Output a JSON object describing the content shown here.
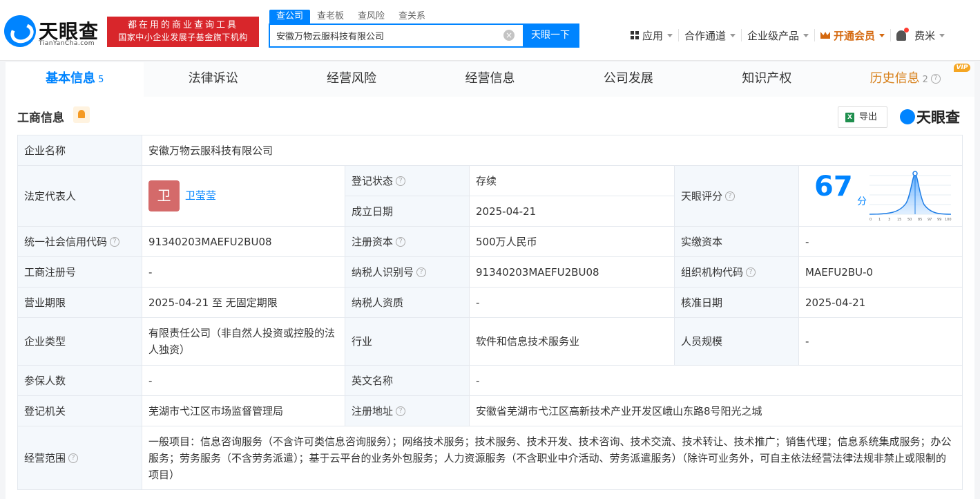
{
  "brand": {
    "name": "天眼查",
    "domain": "TianYanCha.com",
    "promo_line1": "都在用的商业查询工具",
    "promo_line2": "国家中小企业发展子基金旗下机构"
  },
  "search": {
    "tabs": [
      "查公司",
      "查老板",
      "查风险",
      "查关系"
    ],
    "value": "安徽万物云服科技有限公司",
    "button": "天眼一下"
  },
  "nav": {
    "apps": "应用",
    "partners": "合作通道",
    "enterprise": "企业级产品",
    "vip": "开通会员",
    "user": "费米"
  },
  "main_tabs": [
    {
      "label": "基本信息",
      "count": "5"
    },
    {
      "label": "法律诉讼"
    },
    {
      "label": "经营风险"
    },
    {
      "label": "经营信息"
    },
    {
      "label": "公司发展"
    },
    {
      "label": "知识产权"
    },
    {
      "label": "历史信息",
      "count": "2",
      "badge": "VIP"
    }
  ],
  "panel": {
    "title": "工商信息",
    "export": "导出",
    "brand": "天眼查"
  },
  "info": {
    "company_name_label": "企业名称",
    "company_name": "安徽万物云服科技有限公司",
    "legal_rep_label": "法定代表人",
    "legal_rep_avatar": "卫",
    "legal_rep": "卫莹莹",
    "reg_status_label": "登记状态",
    "reg_status": "存续",
    "found_date_label": "成立日期",
    "found_date": "2025-04-21",
    "score_label": "天眼评分",
    "score": "67",
    "score_unit": "分",
    "score_axis": [
      "0",
      "1",
      "3",
      "15",
      "50",
      "85",
      "97",
      "99",
      "100"
    ],
    "credit_code_label": "统一社会信用代码",
    "credit_code": "91340203MAEFU2BU08",
    "reg_capital_label": "注册资本",
    "reg_capital": "500万人民币",
    "paid_capital_label": "实缴资本",
    "paid_capital": "-",
    "reg_no_label": "工商注册号",
    "reg_no": "-",
    "tax_id_label": "纳税人识别号",
    "tax_id": "91340203MAEFU2BU08",
    "org_code_label": "组织机构代码",
    "org_code": "MAEFU2BU-0",
    "term_label": "营业期限",
    "term": "2025-04-21 至 无固定期限",
    "taxpayer_label": "纳税人资质",
    "taxpayer": "-",
    "approve_date_label": "核准日期",
    "approve_date": "2025-04-21",
    "type_label": "企业类型",
    "type": "有限责任公司（非自然人投资或控股的法人独资）",
    "industry_label": "行业",
    "industry": "软件和信息技术服务业",
    "staff_label": "人员规模",
    "staff": "-",
    "insured_label": "参保人数",
    "insured": "-",
    "en_name_label": "英文名称",
    "en_name": "-",
    "authority_label": "登记机关",
    "authority": "芜湖市弋江区市场监督管理局",
    "address_label": "注册地址",
    "address": "安徽省芜湖市弋江区高新技术产业开发区峨山东路8号阳光之城",
    "scope_label": "经营范围",
    "scope": "一般项目：信息咨询服务（不含许可类信息咨询服务）；网络技术服务；技术服务、技术开发、技术咨询、技术交流、技术转让、技术推广；销售代理；信息系统集成服务；办公服务；劳务服务（不含劳务派遣）；基于云平台的业务外包服务；人力资源服务（不含职业中介活动、劳务派遣服务）（除许可业务外，可自主依法经营法律法规非禁止或限制的项目）"
  },
  "colors": {
    "accent": "#0084ff",
    "status_green": "#1aa05b",
    "vip_orange": "#d88320",
    "promo_red": "#d8262b"
  }
}
